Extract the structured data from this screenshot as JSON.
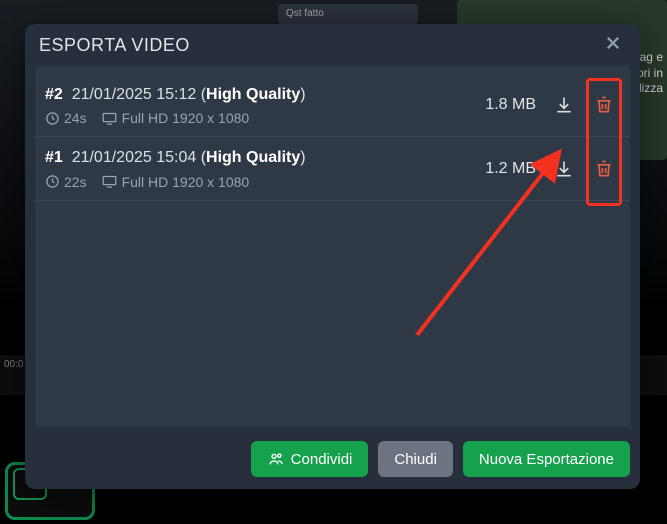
{
  "bg": {
    "card_label": "Qst fatto",
    "side_text": "ni tag e\neriori in\nnalizza",
    "timecode": "00:0"
  },
  "modal": {
    "title": "ESPORTA VIDEO"
  },
  "exports": [
    {
      "index": "#2",
      "date": "21/01/2025 15:12",
      "quality": "High Quality",
      "duration": "24s",
      "resolution": "Full HD 1920 x 1080",
      "size": "1.8 MB"
    },
    {
      "index": "#1",
      "date": "21/01/2025 15:04",
      "quality": "High Quality",
      "duration": "22s",
      "resolution": "Full HD 1920 x 1080",
      "size": "1.2 MB"
    }
  ],
  "footer": {
    "share": "Condividi",
    "close": "Chiudi",
    "new_export": "Nuova Esportazione"
  }
}
